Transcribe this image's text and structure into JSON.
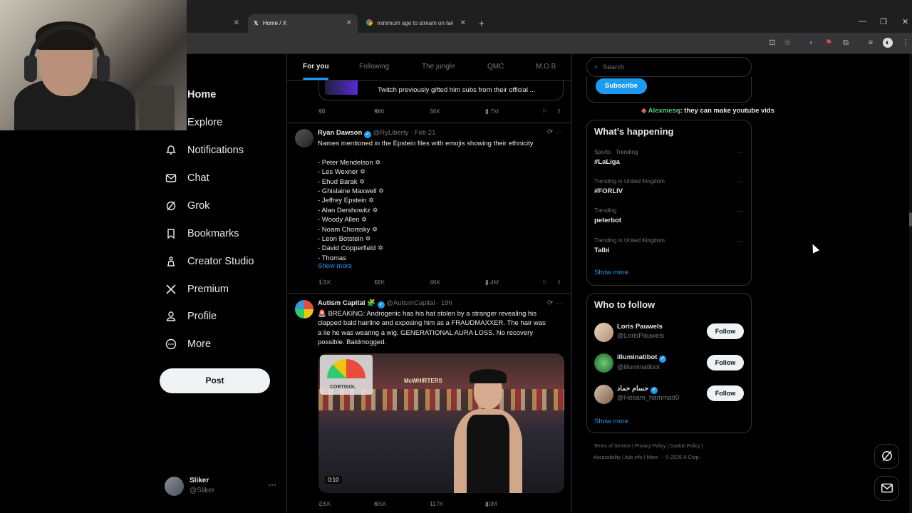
{
  "browser": {
    "tabs": [
      {
        "title": "",
        "active": false
      },
      {
        "title": "Home / X",
        "active": true
      },
      {
        "title": "minimum age to stream on twi",
        "active": false
      }
    ],
    "new_tab": "+",
    "window_controls": [
      "—",
      "❐",
      "✕"
    ]
  },
  "sidebar": {
    "nav": [
      {
        "label": "Home",
        "icon": "home-icon"
      },
      {
        "label": "Explore",
        "icon": "search-icon"
      },
      {
        "label": "Notifications",
        "icon": "bell-icon"
      },
      {
        "label": "Chat",
        "icon": "mail-icon"
      },
      {
        "label": "Grok",
        "icon": "grok-icon"
      },
      {
        "label": "Bookmarks",
        "icon": "bookmark-icon"
      },
      {
        "label": "Creator Studio",
        "icon": "creator-icon"
      },
      {
        "label": "Premium",
        "icon": "x-logo-icon"
      },
      {
        "label": "Profile",
        "icon": "person-icon"
      },
      {
        "label": "More",
        "icon": "more-circle-icon"
      }
    ],
    "post_label": "Post",
    "account": {
      "name": "Sliker",
      "handle": "@Sliker",
      "menu": "···"
    }
  },
  "feed": {
    "tabs": [
      "For you",
      "Following",
      "The jungle",
      "QMC",
      "M.O.B"
    ],
    "quoted_text": "Twitch previously gifted him subs from their official ...",
    "tweet0_actions": {
      "replies": "96",
      "reposts": "986",
      "likes": "36K",
      "views": "2.7M"
    },
    "tweet1": {
      "name": "Ryan Dawson",
      "handle": "@RyLiberty",
      "time": "· Feb 21",
      "text": "Names mentioned in the Epstein files with emojis showing their ethnicity\n\n- Peter Mendelson ✡\n- Les Wexner ✡\n- Ehud Barak ✡\n- Ghislaine Maxwell ✡\n- Jeffrey Epstein ✡\n- Alan Dershowitz ✡\n- Woody Allen ✡\n- Noam Chomsky ✡\n- Leon Botstein ✡\n- David Copperfield ✡\n- Thomas",
      "show_more": "Show more",
      "actions": {
        "replies": "1.1K",
        "reposts": "12K",
        "likes": "46K",
        "views": "2.4M"
      }
    },
    "tweet2": {
      "name": "Autism Capital 🧩",
      "handle": "@AutismCapital",
      "time": "· 19h",
      "text": "🚨 BREAKING: Androgenic has his hat stolen by a stranger revealing his\nclapped bald hairline and exposing him as a FRAUDMAXXER. The hair was\na lie he was wearing a wig. GENERATIONAL AURA LOSS. No recovery\npossible. Baldmogged.",
      "media_gauge_label": "CORTISOL",
      "media_sign": "McWHIRTERS",
      "media_duration": "0:10",
      "actions": {
        "replies": "2.5K",
        "reposts": "6.5K",
        "likes": "117K",
        "views": "10M"
      }
    }
  },
  "right": {
    "search_placeholder": "Search",
    "subscribe_label": "Subscribe",
    "chat": {
      "user": "Alexmesq",
      "message": ": they can make youtube vids"
    },
    "happening": {
      "title": "What’s happening",
      "trends": [
        {
          "context": "Sports · Trending",
          "name": "#LaLiga"
        },
        {
          "context": "Trending in United Kingdom",
          "name": "#FORLIV"
        },
        {
          "context": "Trending",
          "name": "peterbot"
        },
        {
          "context": "Trending in United Kingdom",
          "name": "Talbi"
        }
      ],
      "show_more": "Show more"
    },
    "who_to_follow": {
      "title": "Who to follow",
      "accounts": [
        {
          "name": "Loris Pauwels",
          "handle": "@LorisPauwels",
          "verified": false
        },
        {
          "name": "illuminatibot",
          "handle": "@illuminatibot",
          "verified": true
        },
        {
          "name": "حسام حماد",
          "handle": "@Hosam_hammad0",
          "verified": true
        }
      ],
      "follow_label": "Follow",
      "show_more": "Show more"
    },
    "footer_line1": "Terms of Service  |   Privacy Policy  |   Cookie Policy  |",
    "footer_line2": "Accessibility  |   Ads info  |   More ···   © 2026 X Corp."
  },
  "colors": {
    "accent": "#1d9bf0",
    "background": "#000000",
    "border": "#2f3336",
    "muted": "#71767b"
  }
}
